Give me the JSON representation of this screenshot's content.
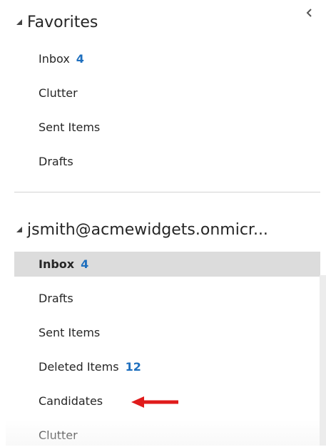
{
  "favorites": {
    "title": "Favorites",
    "items": [
      {
        "label": "Inbox",
        "count": "4"
      },
      {
        "label": "Clutter",
        "count": null
      },
      {
        "label": "Sent Items",
        "count": null
      },
      {
        "label": "Drafts",
        "count": null
      }
    ]
  },
  "mailbox": {
    "title": "jsmith@acmewidgets.onmicr...",
    "items": [
      {
        "label": "Inbox",
        "count": "4",
        "selected": true
      },
      {
        "label": "Drafts",
        "count": null
      },
      {
        "label": "Sent Items",
        "count": null
      },
      {
        "label": "Deleted Items",
        "count": "12"
      },
      {
        "label": "Candidates",
        "count": null
      },
      {
        "label": "Clutter",
        "count": null
      }
    ]
  },
  "colors": {
    "unread_count": "#1e6fbe",
    "selected_background": "#dcdcdc",
    "annotation_arrow": "#e01b1b"
  },
  "icons": {
    "collapse": "chevron-left-icon",
    "expanded": "triangle-expanded-icon",
    "annotation": "red-arrow-left-icon"
  }
}
